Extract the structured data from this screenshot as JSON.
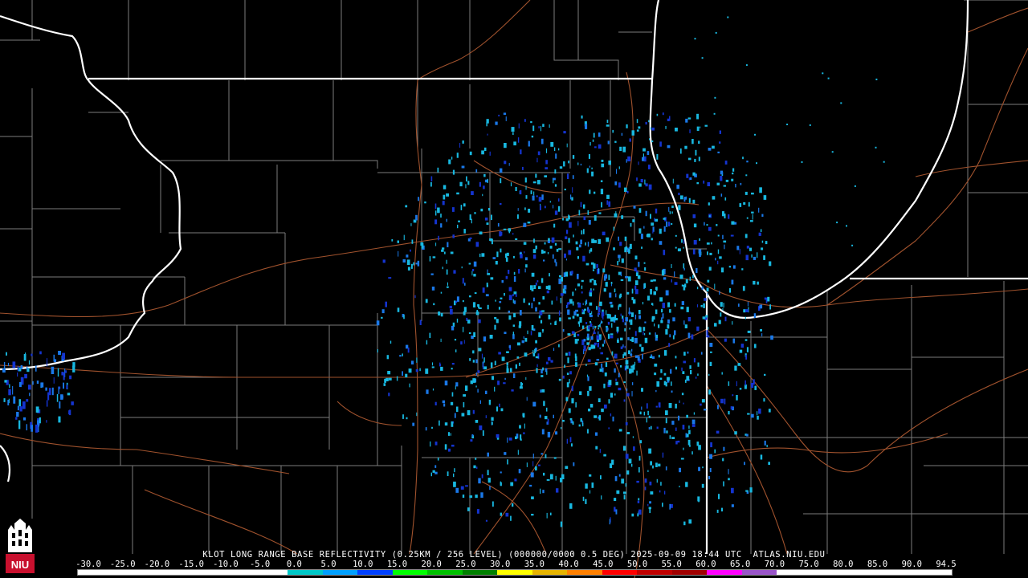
{
  "caption": "KLOT LONG RANGE BASE REFLECTIVITY (0.25KM / 256 LEVEL) (000000/0000 0.5 DEG) 2025-09-09 18:44 UTC  ATLAS.NIU.EDU",
  "colorbar": {
    "ticks": [
      "-30.0",
      "-25.0",
      "-20.0",
      "-15.0",
      "-10.0",
      "-5.0",
      "0.0",
      "5.0",
      "10.0",
      "15.0",
      "20.0",
      "25.0",
      "30.0",
      "35.0",
      "40.0",
      "45.0",
      "50.0",
      "55.0",
      "60.0",
      "65.0",
      "70.0",
      "75.0",
      "80.0",
      "85.0",
      "90.0",
      "94.5"
    ],
    "colors": [
      "#ffffff",
      "#ffffff",
      "#ffffff",
      "#ffffff",
      "#ffffff",
      "#ffffff",
      "#00c8c8",
      "#00a0ff",
      "#0040ff",
      "#00ff00",
      "#00c000",
      "#008000",
      "#ffff00",
      "#e6b400",
      "#ff8000",
      "#ff0000",
      "#c00000",
      "#a00000",
      "#ff00ff",
      "#9955c9",
      "#ffffff",
      "#ffffff",
      "#ffffff",
      "#ffffff",
      "#ffffff"
    ]
  },
  "logo": {
    "text": "NIU",
    "color": "#c8102e"
  },
  "colors": {
    "background": "#000000",
    "state_border": "#ffffff",
    "county_border": "#8a8a8a",
    "highway": "#a0522d",
    "echo_light": "#18b8e0",
    "echo_mid": "#1a78e8",
    "echo_dark": "#1434d0"
  },
  "radar_site": "KLOT"
}
